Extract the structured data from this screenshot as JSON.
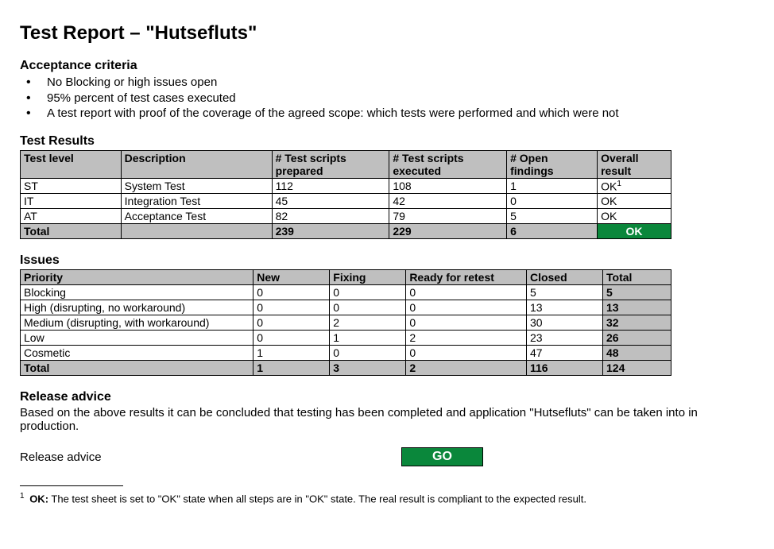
{
  "title": "Test Report – \"Hutsefluts\"",
  "acceptance_heading": "Acceptance criteria",
  "criteria": [
    "No Blocking or high issues open",
    "95% percent of test cases executed",
    "A test report with proof of the coverage of the agreed scope: which tests were performed and which were not"
  ],
  "test_results_heading": "Test Results",
  "test_results_headers": [
    "Test level",
    "Description",
    "# Test scripts prepared",
    "# Test scripts executed",
    "# Open findings",
    "Overall result"
  ],
  "test_results_rows": [
    {
      "level": "ST",
      "desc": "System Test",
      "prepared": "112",
      "executed": "108",
      "open": "1",
      "result": "OK",
      "sup": "1"
    },
    {
      "level": "IT",
      "desc": "Integration Test",
      "prepared": "45",
      "executed": "42",
      "open": "0",
      "result": "OK",
      "sup": ""
    },
    {
      "level": "AT",
      "desc": "Acceptance Test",
      "prepared": "82",
      "executed": "79",
      "open": "5",
      "result": "OK",
      "sup": ""
    }
  ],
  "test_results_total": {
    "label": "Total",
    "prepared": "239",
    "executed": "229",
    "open": "6",
    "result": "OK"
  },
  "issues_heading": "Issues",
  "issues_headers": [
    "Priority",
    "New",
    "Fixing",
    "Ready for retest",
    "Closed",
    "Total"
  ],
  "issues_rows": [
    {
      "priority": "Blocking",
      "new": "0",
      "fixing": "0",
      "ready": "0",
      "closed": "5",
      "total": "5"
    },
    {
      "priority": "High (disrupting, no workaround)",
      "new": "0",
      "fixing": "0",
      "ready": "0",
      "closed": "13",
      "total": "13"
    },
    {
      "priority": "Medium (disrupting, with workaround)",
      "new": "0",
      "fixing": "2",
      "ready": "0",
      "closed": "30",
      "total": "32"
    },
    {
      "priority": "Low",
      "new": "0",
      "fixing": "1",
      "ready": "2",
      "closed": "23",
      "total": "26"
    },
    {
      "priority": "Cosmetic",
      "new": "1",
      "fixing": "0",
      "ready": "0",
      "closed": "47",
      "total": "48"
    }
  ],
  "issues_total": {
    "label": "Total",
    "new": "1",
    "fixing": "3",
    "ready": "2",
    "closed": "116",
    "total": "124"
  },
  "release_heading": "Release advice",
  "release_text": "Based on the above results it can be concluded that testing has been completed and application \"Hutsefluts\" can be taken into in production.",
  "release_label": "Release advice",
  "release_decision": "GO",
  "footnote_label": "OK:",
  "footnote_text": " The test sheet is set to \"OK\" state when all steps are in \"OK\" state. The real result is compliant to the expected result.",
  "footnote_sup": "1"
}
